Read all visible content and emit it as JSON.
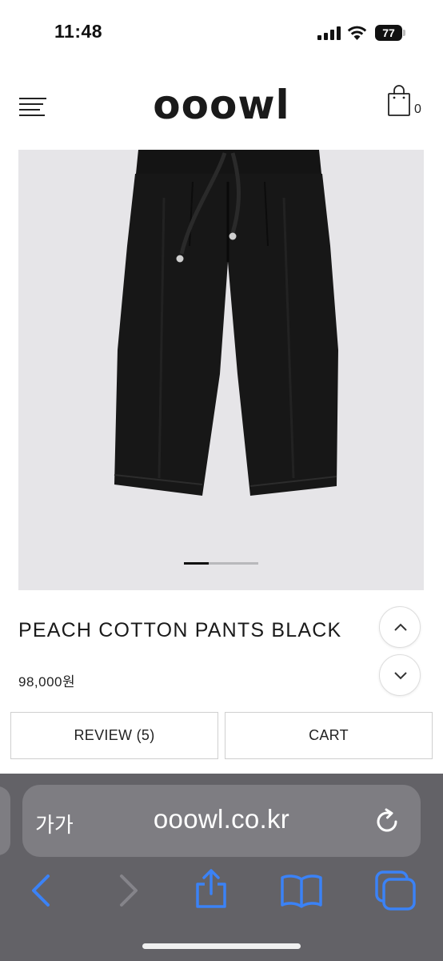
{
  "status_bar": {
    "time": "11:48",
    "battery": "77"
  },
  "header": {
    "logo": "ooowl",
    "cart_count": "0",
    "icons": [
      "menu-icon",
      "shopping-bag-icon"
    ]
  },
  "product": {
    "title": "PEACH COTTON PANTS BLACK",
    "price": "98,000원",
    "image_slide": {
      "current": 1,
      "total": 3
    }
  },
  "actions": {
    "review_label": "REVIEW (5)",
    "cart_label": "CART"
  },
  "browser": {
    "text_size_label": "가가",
    "url": "ooowl.co.kr",
    "toolbar_icons": [
      "back-icon",
      "forward-icon",
      "share-icon",
      "bookmarks-icon",
      "tabs-icon"
    ]
  },
  "colors": {
    "browser_bar": "#636267",
    "url_pill": "#7e7d82",
    "toolbar_accent": "#3b82f6",
    "image_background": "#e6e5e8"
  }
}
